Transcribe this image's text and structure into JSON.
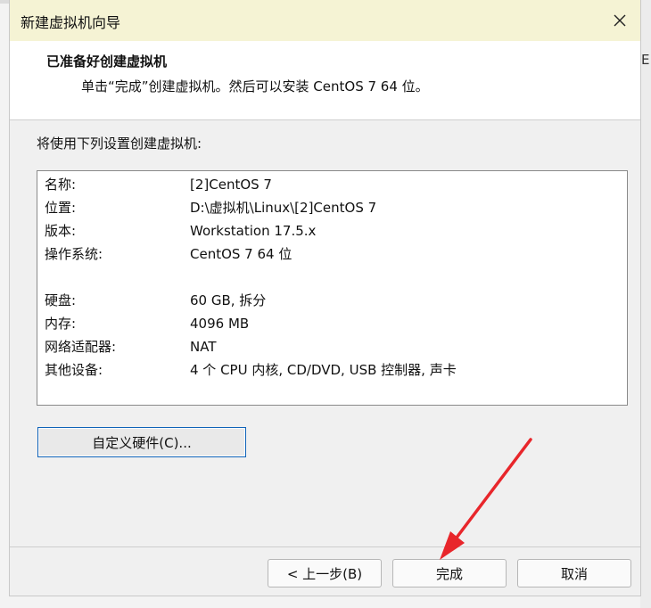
{
  "window": {
    "title": "新建虚拟机向导",
    "backdrop_peek_text": "E"
  },
  "header": {
    "title": "已准备好创建虚拟机",
    "subtitle": "单击“完成”创建虚拟机。然后可以安装 CentOS 7 64 位。"
  },
  "summary": {
    "intro": "将使用下列设置创建虚拟机:",
    "rows": [
      {
        "label": "名称:",
        "value": "[2]CentOS 7"
      },
      {
        "label": "位置:",
        "value": "D:\\虚拟机\\Linux\\[2]CentOS 7"
      },
      {
        "label": "版本:",
        "value": "Workstation 17.5.x"
      },
      {
        "label": "操作系统:",
        "value": "CentOS 7 64 位"
      },
      {
        "label": "硬盘:",
        "value": "60 GB, 拆分"
      },
      {
        "label": "内存:",
        "value": "4096 MB"
      },
      {
        "label": "网络适配器:",
        "value": "NAT"
      },
      {
        "label": "其他设备:",
        "value": "4 个 CPU 内核, CD/DVD, USB 控制器, 声卡"
      }
    ]
  },
  "buttons": {
    "customize": "自定义硬件(C)...",
    "back": "< 上一步(B)",
    "finish": "完成",
    "cancel": "取消"
  },
  "icons": {
    "close": "close-icon",
    "annotation_arrow": "red-arrow-icon"
  },
  "colors": {
    "titlebar_bg": "#f5f3d4",
    "focus_border": "#0e62b8",
    "annotation_arrow": "#e8262b"
  }
}
